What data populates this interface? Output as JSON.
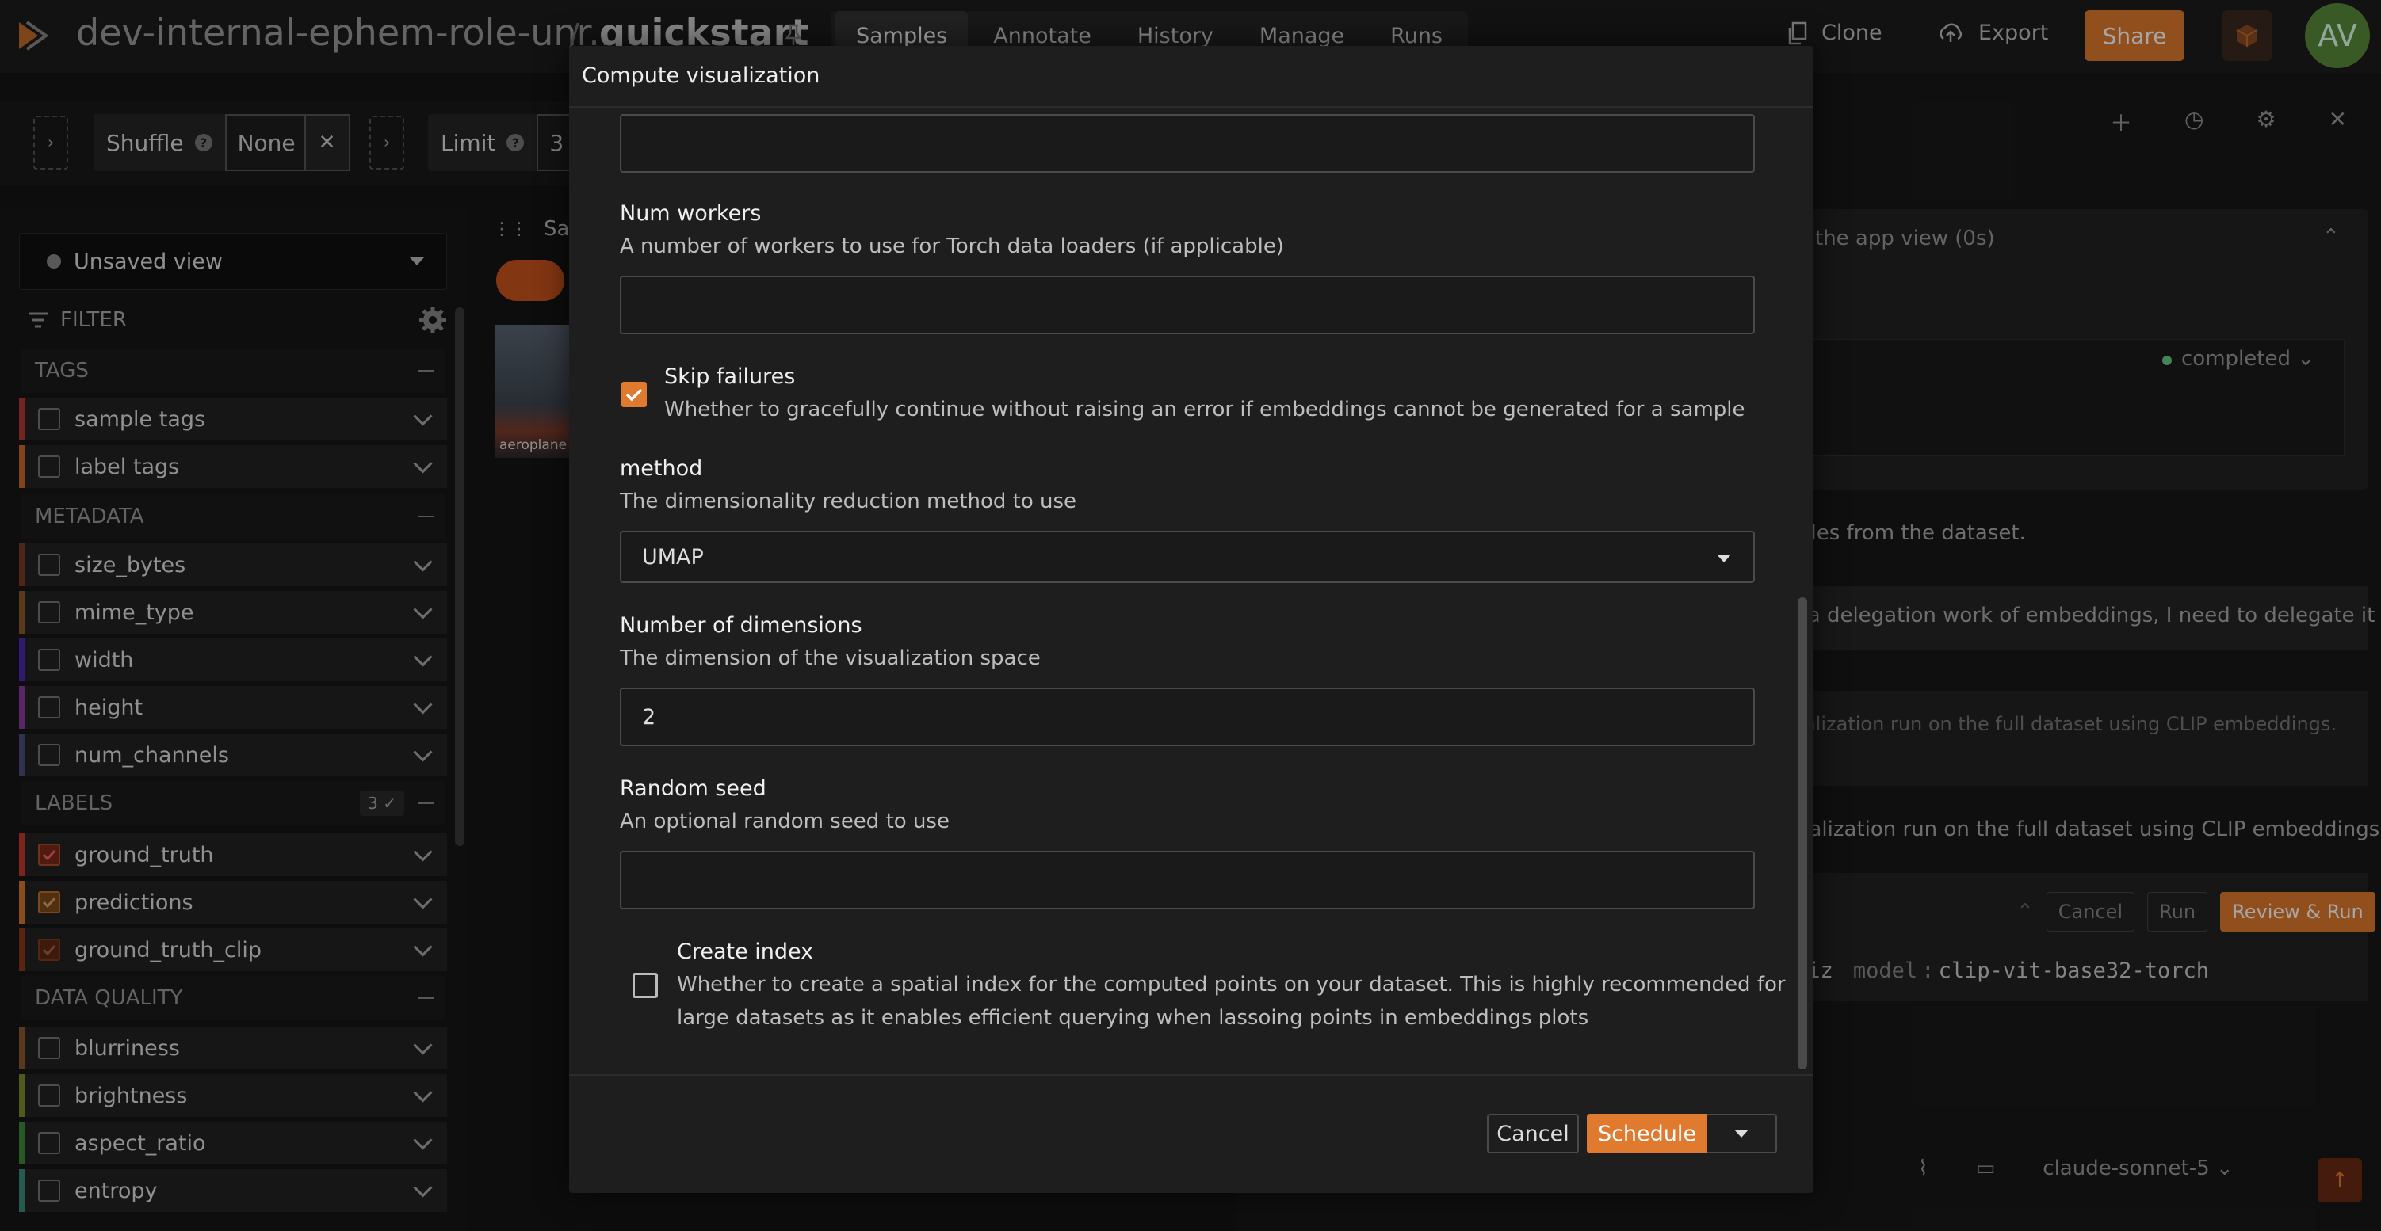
{
  "topbar": {
    "dataset_name": "dev-internal-ephem-role-unr...",
    "separator": "/",
    "view_name": "quickstart",
    "nav_tabs": [
      "Samples",
      "Annotate",
      "History",
      "Manage",
      "Runs"
    ],
    "active_tab": "Samples",
    "clone_label": "Clone",
    "export_label": "Export",
    "share_label": "Share",
    "avatar_initials": "AV"
  },
  "toolbar": {
    "shuffle_label": "Shuffle",
    "shuffle_value": "None",
    "limit_label": "Limit",
    "limit_value": "3"
  },
  "sidebar": {
    "view_selector": "Unsaved view",
    "filter_label": "FILTER",
    "sections": {
      "tags": "TAGS",
      "metadata": "METADATA",
      "labels": "LABELS",
      "labels_count": "3",
      "data_quality": "DATA QUALITY"
    },
    "items": [
      {
        "label": "sample tags",
        "checked": false,
        "color": "#b03a2e"
      },
      {
        "label": "label tags",
        "checked": false,
        "color": "#c8662a"
      },
      {
        "label": "size_bytes",
        "checked": false,
        "color": "#7a3a26"
      },
      {
        "label": "mime_type",
        "checked": false,
        "color": "#8a5a2a"
      },
      {
        "label": "width",
        "checked": false,
        "color": "#4a2ab0"
      },
      {
        "label": "height",
        "checked": false,
        "color": "#8a3aa0"
      },
      {
        "label": "num_channels",
        "checked": false,
        "color": "#4a4a7a"
      },
      {
        "label": "ground_truth",
        "checked": true,
        "color": "#c0392b"
      },
      {
        "label": "predictions",
        "checked": true,
        "color": "#d4762a"
      },
      {
        "label": "ground_truth_clip",
        "checked": true,
        "color": "#8a3a1a"
      },
      {
        "label": "blurriness",
        "checked": false,
        "color": "#8a5a2a"
      },
      {
        "label": "brightness",
        "checked": false,
        "color": "#7a8a2a"
      },
      {
        "label": "aspect_ratio",
        "checked": false,
        "color": "#3a8a3a"
      },
      {
        "label": "entropy",
        "checked": false,
        "color": "#3a8a7a"
      }
    ]
  },
  "grid": {
    "tab_label": "Sam",
    "thumb_label": "aeroplane"
  },
  "right_panel": {
    "app_view_text": "the app view (0s)",
    "status": "completed",
    "line1": "ples from the dataset.",
    "line2": "n a delegation work of embeddings, I need to delegate it",
    "line3": "alization run on the full dataset using CLIP embeddings.",
    "line4": "ualization run on the full dataset using CLIP embeddings.",
    "cancel_label": "Cancel",
    "run_label": "Run",
    "review_label": "Review & Run",
    "code_prefix": "viz",
    "code_key": "model",
    "code_colon": ":",
    "code_value": "clip-vit-base32-torch",
    "model_selector": "claude-sonnet-5"
  },
  "modal": {
    "title": "Compute visualization",
    "num_workers_label": "Num workers",
    "num_workers_desc": "A number of workers to use for Torch data loaders (if applicable)",
    "num_workers_value": "",
    "skip_failures_label": "Skip failures",
    "skip_failures_desc": "Whether to gracefully continue without raising an error if embeddings cannot be generated for a sample",
    "skip_failures_checked": true,
    "method_label": "method",
    "method_desc": "The dimensionality reduction method to use",
    "method_value": "UMAP",
    "num_dims_label": "Number of dimensions",
    "num_dims_desc": "The dimension of the visualization space",
    "num_dims_value": "2",
    "seed_label": "Random seed",
    "seed_desc": "An optional random seed to use",
    "seed_value": "",
    "create_index_label": "Create index",
    "create_index_desc_1": "Whether to create a spatial index for the computed points on your dataset. This is highly recommended for",
    "create_index_desc_2": "large datasets as it enables efficient querying when lassoing points in embeddings plots",
    "create_index_checked": false,
    "cancel_label": "Cancel",
    "schedule_label": "Schedule"
  },
  "colors": {
    "accent": "#e07a2f",
    "background": "#141414",
    "modal_bg": "#1e1e1e"
  }
}
